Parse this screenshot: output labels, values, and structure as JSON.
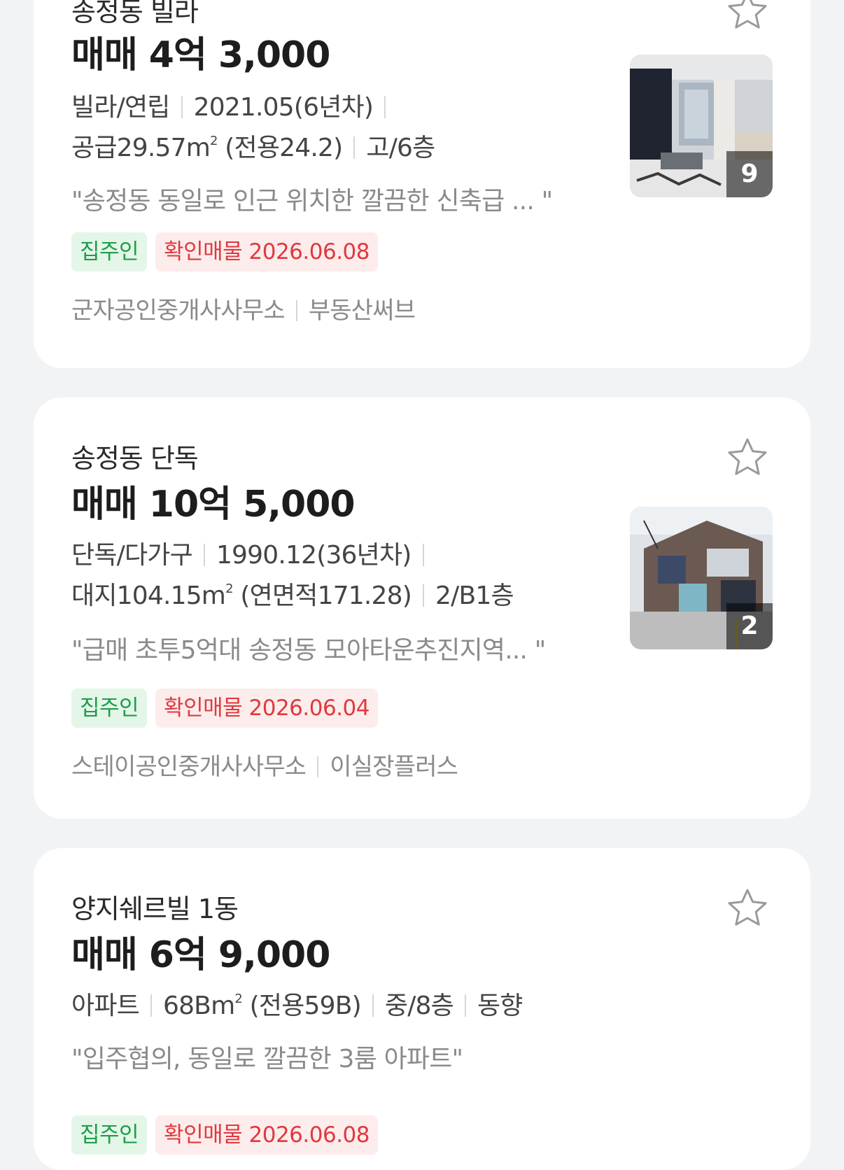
{
  "listings": [
    {
      "title": "송정동 빌라",
      "price": "매매 4억 3,000",
      "type": "빌라/연립",
      "built": "2021.05(6년차)",
      "area": "공급29.57m",
      "area_unit_sup": "2",
      "area_detail": "(전용24.2)",
      "floor": "고/6층",
      "description": "\"송정동 동일로 인근 위치한 깔끔한 신축급 ... \"",
      "tag_owner": "집주인",
      "tag_verified": "확인매물 2026.06.08",
      "agency": "군자공인중개사사무소",
      "source": "부동산써브",
      "photo_count": "9",
      "star_icon": "star-outline-icon"
    },
    {
      "title": "송정동 단독",
      "price": "매매 10억 5,000",
      "type": "단독/다가구",
      "built": "1990.12(36년차)",
      "area": "대지104.15m",
      "area_unit_sup": "2",
      "area_detail": "(연면적171.28)",
      "floor": "2/B1층",
      "description": "\"급매 초투5억대 송정동 모아타운추진지역... \"",
      "tag_owner": "집주인",
      "tag_verified": "확인매물 2026.06.04",
      "agency": "스테이공인중개사사무소",
      "source": "이실장플러스",
      "photo_count": "2",
      "star_icon": "star-outline-icon"
    },
    {
      "title": "양지쉐르빌 1동",
      "price": "매매 6억 9,000",
      "type": "아파트",
      "area": "68Bm",
      "area_unit_sup": "2",
      "area_detail": "(전용59B)",
      "floor": "중/8층",
      "direction": "동향",
      "description": "\"입주협의, 동일로 깔끔한 3룸 아파트\"",
      "tag_owner": "집주인",
      "tag_verified": "확인매물 2026.06.08",
      "star_icon": "star-outline-icon"
    }
  ],
  "colors": {
    "owner_tag_bg": "#e4f6e8",
    "owner_tag_text": "#1f9d4c",
    "verified_tag_bg": "#fdecec",
    "verified_tag_text": "#e0393e"
  }
}
